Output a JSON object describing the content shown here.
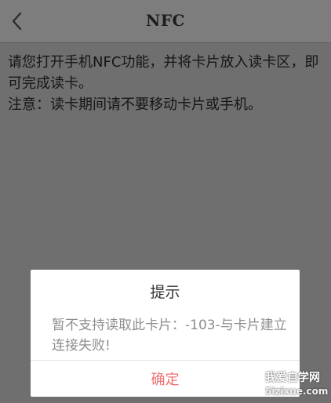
{
  "header": {
    "title": "NFC",
    "back_icon": "chevron-left-icon"
  },
  "content": {
    "instruction": "请您打开手机NFC功能，并将卡片放入读卡区，即可完成读卡。",
    "note": "注意：读卡期间请不要移动卡片或手机。"
  },
  "dialog": {
    "title": "提示",
    "message": "暂不支持读取此卡片：-103-与卡片建立连接失败!",
    "confirm_label": "确定"
  },
  "watermark": {
    "line1": "我爱自学网",
    "line2": "5izixue.com"
  },
  "colors": {
    "overlay": "#6f6f6f",
    "header": "#7d7d7d",
    "dialog_bg": "#ffffff",
    "confirm": "#f07070",
    "message": "#8e8e8e"
  }
}
